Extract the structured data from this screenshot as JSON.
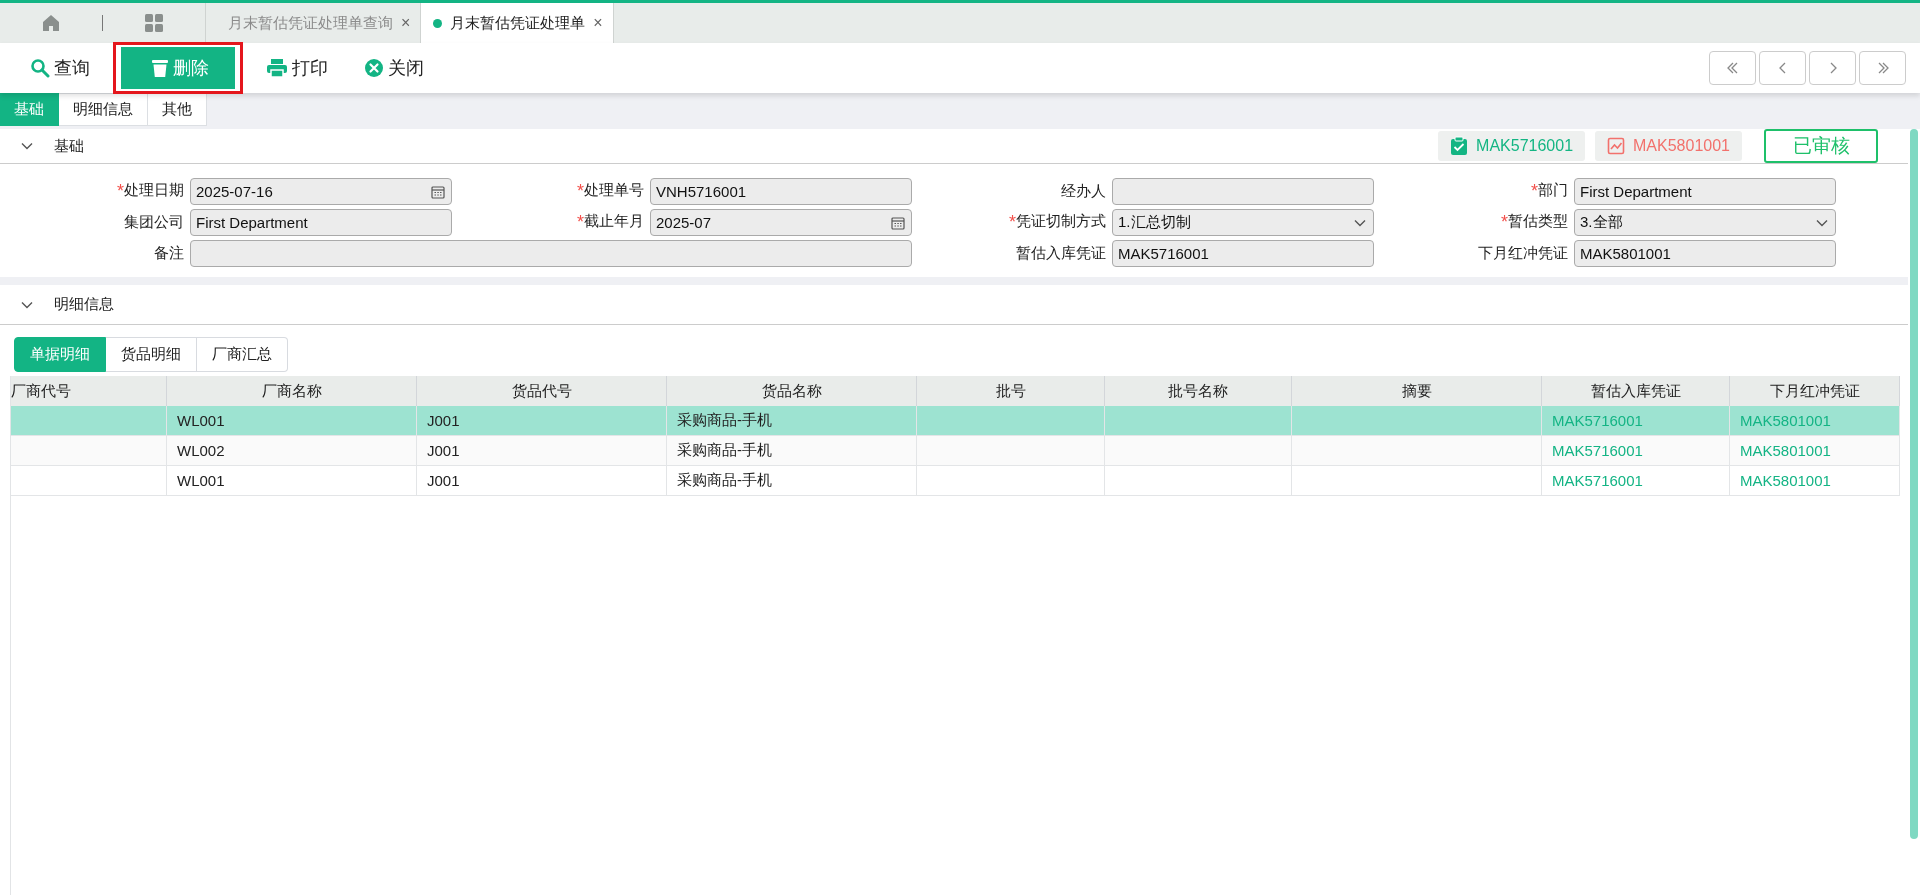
{
  "window_tabs": [
    {
      "label": "月末暂估凭证处理单查询",
      "selected": false,
      "close": "×"
    },
    {
      "label": "月末暂估凭证处理单",
      "selected": true,
      "close": "×"
    }
  ],
  "toolbar": [
    {
      "kind": "search",
      "label": "查询",
      "highlighted": false
    },
    {
      "kind": "delete",
      "label": "删除",
      "highlighted": true
    },
    {
      "kind": "print",
      "label": "打印",
      "highlighted": false
    },
    {
      "kind": "close",
      "label": "关闭",
      "highlighted": false
    }
  ],
  "page_tabs": [
    {
      "label": "基础",
      "selected": true
    },
    {
      "label": "明细信息",
      "selected": false
    },
    {
      "label": "其他",
      "selected": false
    }
  ],
  "basic_section": {
    "title": "基础",
    "expanded": true,
    "badges": [
      {
        "kind": "inbound",
        "text": "MAK5716001",
        "color": "#14b583"
      },
      {
        "kind": "reversal",
        "text": "MAK5801001",
        "color": "#f2716c"
      }
    ],
    "status": "已审核",
    "fields": [
      {
        "label": "处理日期",
        "required_mark": "*",
        "kind": "date",
        "value": "2025-07-16"
      },
      {
        "label": "处理单号",
        "required_mark": "*",
        "kind": "text",
        "value": "VNH5716001"
      },
      {
        "label": "经办人",
        "kind": "text"
      },
      {
        "label": "部门",
        "required_mark": "*",
        "kind": "text",
        "value": "First Department"
      },
      {
        "label": "集团公司",
        "kind": "text",
        "value": "First Department"
      },
      {
        "label": "截止年月",
        "required_mark": "*",
        "kind": "date",
        "value": "2025-07"
      },
      {
        "label": "凭证切制方式",
        "required_mark": "*",
        "kind": "select",
        "value": "1.汇总切制"
      },
      {
        "label": "暂估类型",
        "required_mark": "*",
        "kind": "select",
        "value": "3.全部"
      },
      {
        "label": "备注",
        "kind": "wide"
      },
      {
        "label": "暂估入库凭证",
        "kind": "text",
        "value": "MAK5716001"
      },
      {
        "label": "下月红冲凭证",
        "kind": "text",
        "value": "MAK5801001"
      }
    ]
  },
  "detail_section": {
    "title": "明细信息",
    "expanded": true,
    "tabs": [
      {
        "label": "单据明细",
        "selected": true
      },
      {
        "label": "货品明细",
        "selected": false
      },
      {
        "label": "厂商汇总",
        "selected": false
      }
    ],
    "table": {
      "columns": [
        {
          "label": "厂商代号",
          "kind": "text"
        },
        {
          "label": "厂商名称",
          "kind": "text"
        },
        {
          "label": "货品代号",
          "kind": "text"
        },
        {
          "label": "货品名称",
          "kind": "text"
        },
        {
          "label": "批号",
          "kind": "text"
        },
        {
          "label": "批号名称",
          "kind": "text"
        },
        {
          "label": "摘要",
          "kind": "text"
        },
        {
          "label": "暂估入库凭证",
          "kind": "link"
        },
        {
          "label": "下月红冲凭证",
          "kind": "link"
        }
      ],
      "rows": [
        {
          "selected": true,
          "vendor_name": "WL001",
          "goods_code": "J001",
          "goods_name": "采购商品-手机",
          "inbound_voucher": "MAK5716001",
          "reversal_voucher": "MAK5801001"
        },
        {
          "selected": false,
          "vendor_name": "WL002",
          "goods_code": "J001",
          "goods_name": "采购商品-手机",
          "inbound_voucher": "MAK5716001",
          "reversal_voucher": "MAK5801001"
        },
        {
          "selected": false,
          "vendor_name": "WL001",
          "goods_code": "J001",
          "goods_name": "采购商品-手机",
          "inbound_voucher": "MAK5716001",
          "reversal_voucher": "MAK5801001"
        }
      ]
    }
  }
}
